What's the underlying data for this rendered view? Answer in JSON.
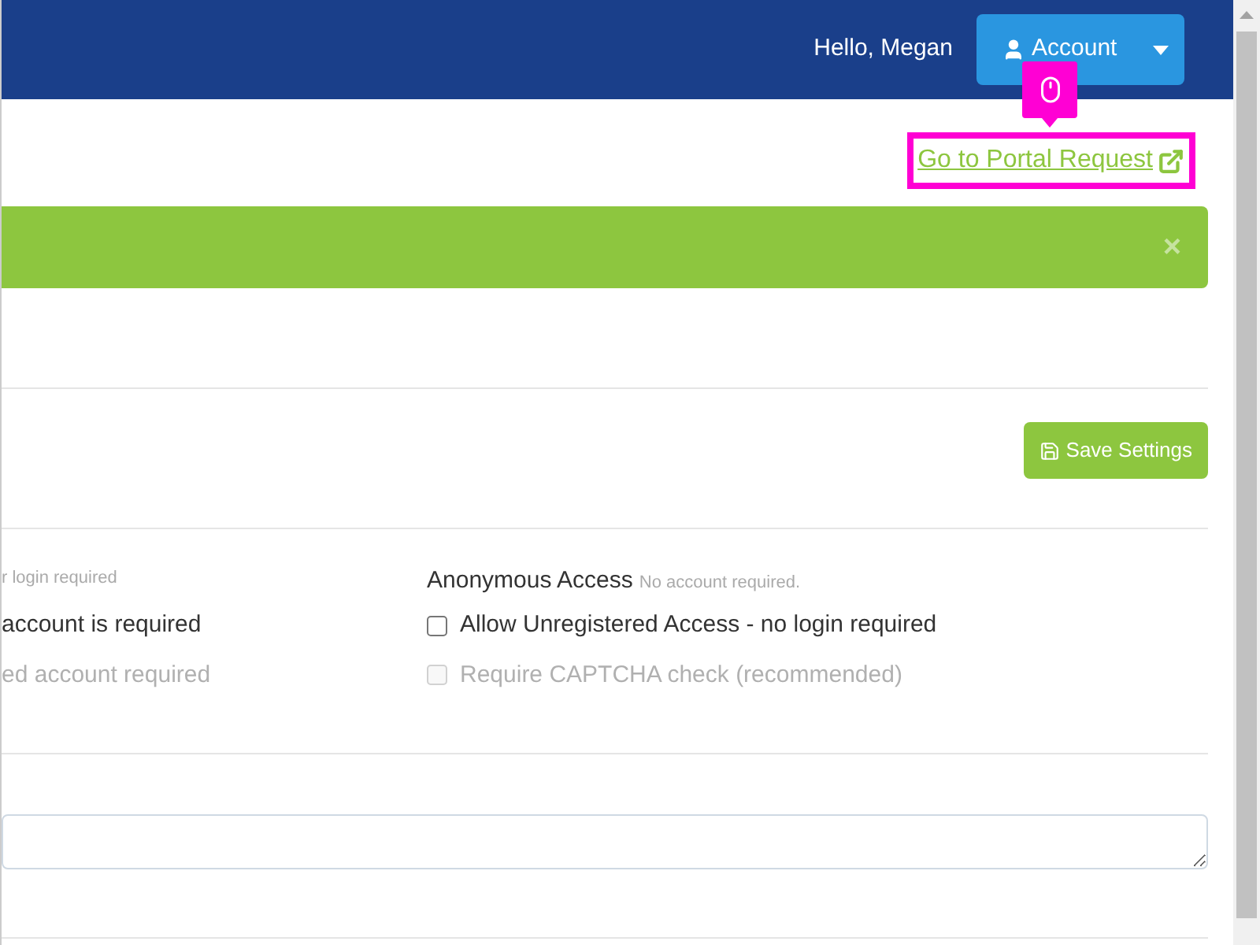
{
  "navbar": {
    "greeting": "Hello, Megan",
    "account_button": "Account"
  },
  "links": [
    {
      "label": "Go to Portal Request",
      "highlighted": true
    }
  ],
  "alert": {
    "close": "×"
  },
  "save_button": "Save Settings",
  "access": {
    "left": {
      "hint": "r login required",
      "options": [
        {
          "label": "account is required",
          "disabled": false
        },
        {
          "label": "ed account required",
          "disabled": true
        }
      ]
    },
    "right": {
      "title": "Anonymous Access",
      "hint": "No account required.",
      "options": [
        {
          "label": "Allow Unregistered Access - no login required",
          "checked": false,
          "disabled": false
        },
        {
          "label": "Require CAPTCHA check (recommended)",
          "checked": false,
          "disabled": true
        }
      ]
    }
  }
}
